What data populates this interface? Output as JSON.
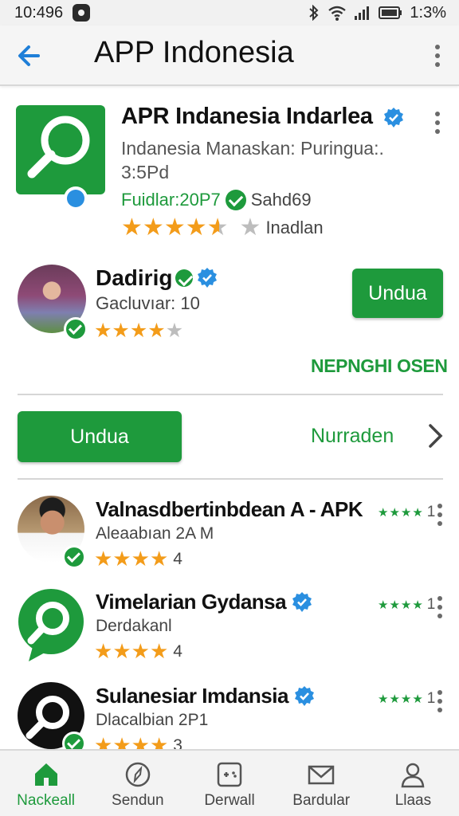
{
  "status_bar": {
    "time": "10:496",
    "battery": "1:3%"
  },
  "app_bar": {
    "title": "APP Indonesia"
  },
  "app_header": {
    "title": "APR Indanesia Indarlea",
    "subtitle_line1": "Indanesia Manaskan: Puringua:.",
    "subtitle_line2": "3:5Pd",
    "developer_label": "Fuidlar:20P7",
    "developer_name": "Sahd69",
    "rating_label": "Inadlan",
    "rating": 4.5
  },
  "reviewer": {
    "name": "Dadirig",
    "subtitle": "Gacluvıar: 10",
    "rating": 4,
    "install_label": "Undua",
    "more_link": "NEPNGHI OSEN"
  },
  "action_row": {
    "install_label": "Undua",
    "secondary_label": "Nurraden"
  },
  "list": [
    {
      "title": "Valnasdbertinbdean A - APK",
      "subtitle": "Aleaabıan 2A M",
      "rating": 4,
      "count": "4",
      "mini_count": "1",
      "verified": false
    },
    {
      "title": "Vimelarian Gydansa",
      "subtitle": "Derdakanl",
      "rating": 4,
      "count": "4",
      "mini_count": "1",
      "verified": true
    },
    {
      "title": "Sulanesiar Imdansia",
      "subtitle": "Dlacalbian 2P1",
      "rating": 4,
      "count": "3",
      "mini_count": "1",
      "verified": true
    }
  ],
  "bottom_nav": [
    {
      "label": "Nackeall",
      "icon": "home-icon",
      "active": true
    },
    {
      "label": "Sendun",
      "icon": "compass-icon",
      "active": false
    },
    {
      "label": "Derwall",
      "icon": "gamepad-icon",
      "active": false
    },
    {
      "label": "Bardular",
      "icon": "mail-icon",
      "active": false
    },
    {
      "label": "Llaas",
      "icon": "person-icon",
      "active": false
    }
  ],
  "colors": {
    "accent": "#1e9a3c",
    "star": "#f39c1a",
    "verified": "#2a8fe0"
  }
}
